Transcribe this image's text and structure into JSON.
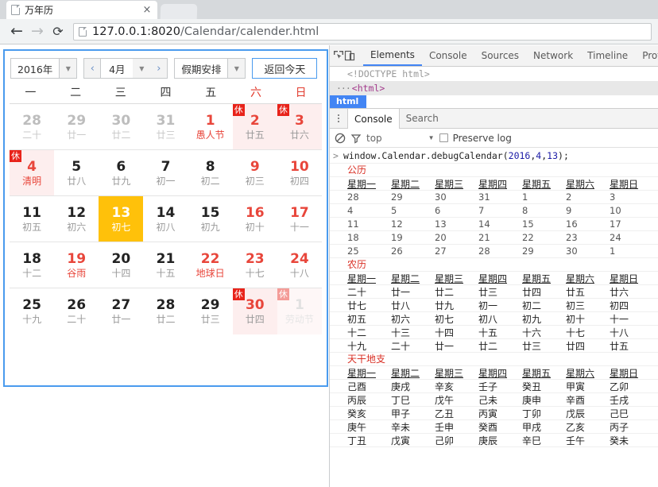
{
  "browser": {
    "tab": {
      "title": "万年历",
      "close_label": "×",
      "icon": "page-icon"
    },
    "nav": {
      "back": "←",
      "forward": "→",
      "reload": "⟳"
    },
    "omnibox": {
      "host": "127.0.0.1:8020",
      "path": "/Calendar/calender.html"
    }
  },
  "calendar": {
    "toolbar": {
      "year_value": "2016年",
      "prev_label": "‹",
      "month_value": "4月",
      "next_label": "›",
      "holiday_value": "假期安排",
      "today_label": "返回今天",
      "caret": "▼"
    },
    "weekdays": [
      {
        "label": "一",
        "weekend": false
      },
      {
        "label": "二",
        "weekend": false
      },
      {
        "label": "三",
        "weekend": false
      },
      {
        "label": "四",
        "weekend": false
      },
      {
        "label": "五",
        "weekend": false
      },
      {
        "label": "六",
        "weekend": true
      },
      {
        "label": "日",
        "weekend": true
      }
    ],
    "rest_badge": "休",
    "weeks": [
      [
        {
          "day": "28",
          "sub": "二十",
          "kind": "other"
        },
        {
          "day": "29",
          "sub": "廿一",
          "kind": "other"
        },
        {
          "day": "30",
          "sub": "廿二",
          "kind": "other"
        },
        {
          "day": "31",
          "sub": "廿三",
          "kind": "other"
        },
        {
          "day": "1",
          "sub": "愚人节",
          "kind": "festival"
        },
        {
          "day": "2",
          "sub": "廿五",
          "kind": "weekend-rest"
        },
        {
          "day": "3",
          "sub": "廿六",
          "kind": "weekend-rest"
        }
      ],
      [
        {
          "day": "4",
          "sub": "清明",
          "kind": "holiday-rest"
        },
        {
          "day": "5",
          "sub": "廿八",
          "kind": "normal"
        },
        {
          "day": "6",
          "sub": "廿九",
          "kind": "normal"
        },
        {
          "day": "7",
          "sub": "初一",
          "kind": "normal"
        },
        {
          "day": "8",
          "sub": "初二",
          "kind": "normal"
        },
        {
          "day": "9",
          "sub": "初三",
          "kind": "weekend"
        },
        {
          "day": "10",
          "sub": "初四",
          "kind": "weekend"
        }
      ],
      [
        {
          "day": "11",
          "sub": "初五",
          "kind": "normal"
        },
        {
          "day": "12",
          "sub": "初六",
          "kind": "normal"
        },
        {
          "day": "13",
          "sub": "初七",
          "kind": "selected"
        },
        {
          "day": "14",
          "sub": "初八",
          "kind": "normal"
        },
        {
          "day": "15",
          "sub": "初九",
          "kind": "normal"
        },
        {
          "day": "16",
          "sub": "初十",
          "kind": "weekend"
        },
        {
          "day": "17",
          "sub": "十一",
          "kind": "weekend"
        }
      ],
      [
        {
          "day": "18",
          "sub": "十二",
          "kind": "normal"
        },
        {
          "day": "19",
          "sub": "谷雨",
          "kind": "festival"
        },
        {
          "day": "20",
          "sub": "十四",
          "kind": "normal"
        },
        {
          "day": "21",
          "sub": "十五",
          "kind": "normal"
        },
        {
          "day": "22",
          "sub": "地球日",
          "kind": "festival"
        },
        {
          "day": "23",
          "sub": "十七",
          "kind": "weekend"
        },
        {
          "day": "24",
          "sub": "十八",
          "kind": "weekend"
        }
      ],
      [
        {
          "day": "25",
          "sub": "十九",
          "kind": "normal"
        },
        {
          "day": "26",
          "sub": "二十",
          "kind": "normal"
        },
        {
          "day": "27",
          "sub": "廿一",
          "kind": "normal"
        },
        {
          "day": "28",
          "sub": "廿二",
          "kind": "normal"
        },
        {
          "day": "29",
          "sub": "廿三",
          "kind": "normal"
        },
        {
          "day": "30",
          "sub": "廿四",
          "kind": "weekend-rest"
        },
        {
          "day": "1",
          "sub": "劳动节",
          "kind": "other-rest"
        }
      ]
    ]
  },
  "devtools": {
    "toolbar_icons": {
      "inspect": "inspect-icon",
      "device": "device-toolbar-icon"
    },
    "tabs": [
      {
        "label": "Elements",
        "active": true
      },
      {
        "label": "Console",
        "active": false
      },
      {
        "label": "Sources",
        "active": false
      },
      {
        "label": "Network",
        "active": false
      },
      {
        "label": "Timeline",
        "active": false
      },
      {
        "label": "Profile",
        "active": false
      }
    ],
    "dom": {
      "doctype": "<!DOCTYPE html>",
      "twisty": "···",
      "html_tag": "<html>"
    },
    "breadcrumb": "html",
    "drawer_tabs": [
      {
        "label": "Console",
        "active": true
      },
      {
        "label": "Search",
        "active": false
      }
    ],
    "console_toolbar": {
      "clear_icon": "⃠",
      "filter_icon": "▽",
      "context": "top",
      "caret": "▼",
      "preserve_log": "Preserve log"
    },
    "command": {
      "prompt": ">",
      "pre": "window.Calendar.debugCalendar(",
      "arg_year": "2016",
      "comma1": ",",
      "arg_month": "4",
      "comma2": ",",
      "arg_day": "13",
      "post": ");"
    },
    "output": [
      {
        "title": "公历",
        "header": [
          "星期一",
          "星期二",
          "星期三",
          "星期四",
          "星期五",
          "星期六",
          "星期日"
        ],
        "rows": [
          [
            "28",
            "29",
            "30",
            "31",
            "1",
            "2",
            "3"
          ],
          [
            "4",
            "5",
            "6",
            "7",
            "8",
            "9",
            "10"
          ],
          [
            "11",
            "12",
            "13",
            "14",
            "15",
            "16",
            "17"
          ],
          [
            "18",
            "19",
            "20",
            "21",
            "22",
            "23",
            "24"
          ],
          [
            "25",
            "26",
            "27",
            "28",
            "29",
            "30",
            "1"
          ]
        ]
      },
      {
        "title": "农历",
        "header": [
          "星期一",
          "星期二",
          "星期三",
          "星期四",
          "星期五",
          "星期六",
          "星期日"
        ],
        "rows": [
          [
            "二十",
            "廿一",
            "廿二",
            "廿三",
            "廿四",
            "廿五",
            "廿六"
          ],
          [
            "廿七",
            "廿八",
            "廿九",
            "初一",
            "初二",
            "初三",
            "初四"
          ],
          [
            "初五",
            "初六",
            "初七",
            "初八",
            "初九",
            "初十",
            "十一"
          ],
          [
            "十二",
            "十三",
            "十四",
            "十五",
            "十六",
            "十七",
            "十八"
          ],
          [
            "十九",
            "二十",
            "廿一",
            "廿二",
            "廿三",
            "廿四",
            "廿五"
          ]
        ]
      },
      {
        "title": "天干地支",
        "header": [
          "星期一",
          "星期二",
          "星期三",
          "星期四",
          "星期五",
          "星期六",
          "星期日"
        ],
        "rows": [
          [
            "己酉",
            "庚戌",
            "辛亥",
            "壬子",
            "癸丑",
            "甲寅",
            "乙卯"
          ],
          [
            "丙辰",
            "丁巳",
            "戊午",
            "己未",
            "庚申",
            "辛酉",
            "壬戌"
          ],
          [
            "癸亥",
            "甲子",
            "乙丑",
            "丙寅",
            "丁卯",
            "戊辰",
            "己巳"
          ],
          [
            "庚午",
            "辛未",
            "壬申",
            "癸酉",
            "甲戌",
            "乙亥",
            "丙子"
          ],
          [
            "丁丑",
            "戊寅",
            "己卯",
            "庚辰",
            "辛巳",
            "壬午",
            "癸未"
          ]
        ]
      }
    ]
  },
  "colors": {
    "accent_blue": "#4a9bee",
    "selected_amber": "#ffc10a",
    "holiday_red": "#e8463b",
    "rest_badge_red": "#e8231a",
    "rest_bg_pink": "#fdeeee",
    "devtools_tab_active": "#4285f4"
  }
}
